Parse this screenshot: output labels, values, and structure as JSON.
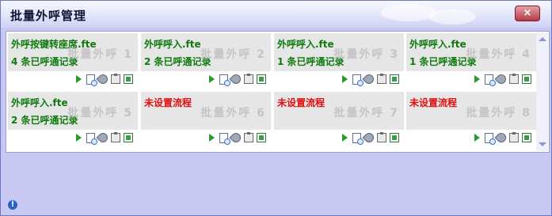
{
  "window": {
    "title": "批量外呼管理",
    "close_label": "×"
  },
  "tasks": [
    {
      "name": "外呼按键转座席.fte",
      "count": "4 条已呼通记录",
      "watermark": "批量外呼 1",
      "configured": true
    },
    {
      "name": "外呼呼入.fte",
      "count": "2 条已呼通记录",
      "watermark": "批量外呼 2",
      "configured": true
    },
    {
      "name": "外呼呼入.fte",
      "count": "1 条已呼通记录",
      "watermark": "批量外呼 3",
      "configured": true
    },
    {
      "name": "外呼呼入.fte",
      "count": "1 条已呼通记录",
      "watermark": "批量外呼 4",
      "configured": true
    },
    {
      "name": "外呼呼入.fte",
      "count": "2 条已呼通记录",
      "watermark": "批量外呼 5",
      "configured": true
    },
    {
      "name": "未设置流程",
      "count": "",
      "watermark": "批量外呼 6",
      "configured": false
    },
    {
      "name": "未设置流程",
      "count": "",
      "watermark": "批量外呼 7",
      "configured": false
    },
    {
      "name": "未设置流程",
      "count": "",
      "watermark": "批量外呼 8",
      "configured": false
    }
  ],
  "task_icons": [
    "play-icon",
    "preview-icon",
    "settings-icon",
    "clipboard-icon",
    "export-icon"
  ],
  "colors": {
    "configured": "#0e7a0e",
    "unconfigured": "#e01010",
    "watermark": "#c4c4c4",
    "frame": "#c9c8f3"
  }
}
